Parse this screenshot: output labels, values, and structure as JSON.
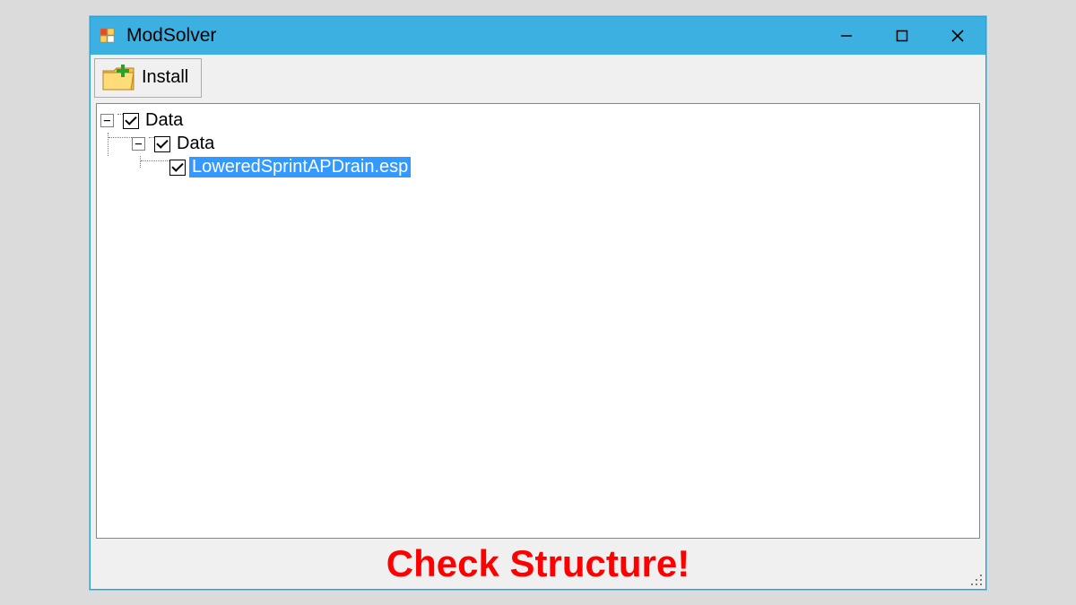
{
  "window": {
    "title": "ModSolver"
  },
  "toolbar": {
    "install_label": "Install"
  },
  "tree": {
    "root": {
      "label": "Data",
      "expanded": true,
      "checked": true,
      "children": [
        {
          "label": "Data",
          "expanded": true,
          "checked": true,
          "children": [
            {
              "label": "LoweredSprintAPDrain.esp",
              "checked": true,
              "selected": true
            }
          ]
        }
      ]
    }
  },
  "footer": {
    "message": "Check Structure!"
  }
}
